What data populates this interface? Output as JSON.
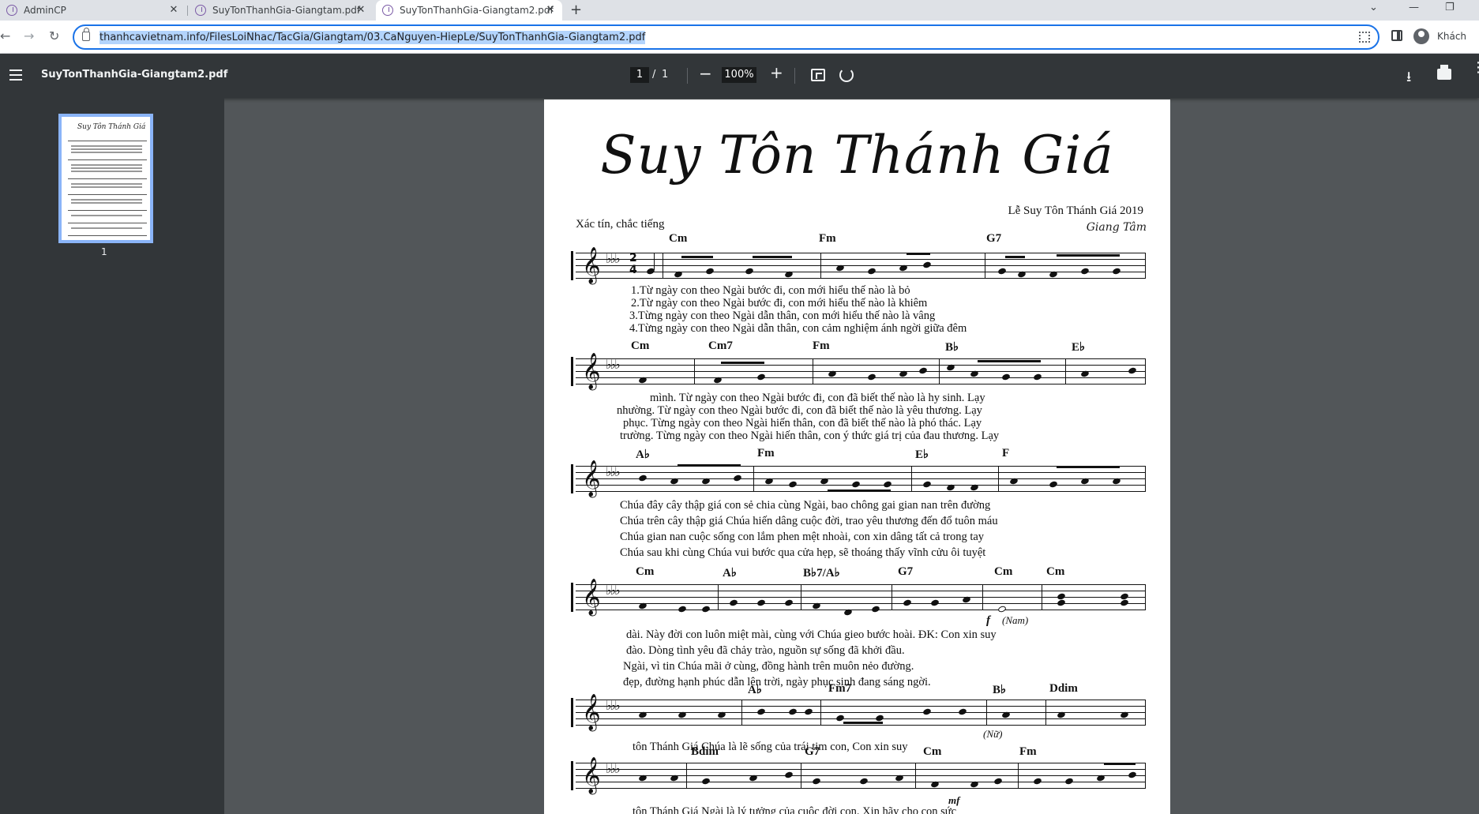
{
  "browser": {
    "tabs": [
      {
        "label": "AdminCP",
        "active": false
      },
      {
        "label": "SuyTonThanhGia-Giangtam.pdf",
        "active": false
      },
      {
        "label": "SuyTonThanhGia-Giangtam2.pdf",
        "active": true
      }
    ],
    "url": "thanhcavietnam.info/FilesLoiNhac/TacGia/Giangtam/03.CaNguyen-HiepLe/SuyTonThanhGia-Giangtam2.pdf",
    "profile_label": "Khách"
  },
  "pdf_viewer": {
    "doc_title": "SuyTonThanhGia-Giangtam2.pdf",
    "page_current": "1",
    "page_sep": "/",
    "page_total": "1",
    "zoom": "100%",
    "thumb_page_number": "1"
  },
  "sheet": {
    "title": "Suy Tôn Thánh Giá",
    "subtitle": "Lễ Suy Tôn Thánh Giá 2019",
    "tempo": "Xác tín, chắc tiếng",
    "composer": "Giang Tâm",
    "systems": [
      {
        "chords": [
          "Cm",
          "Fm",
          "G7"
        ],
        "lyrics": [
          "1.Từ  ngày  con  theo  Ngài  bước  đi,  con  mới  hiểu  thế  nào  là  bỏ",
          "2.Từ  ngày  con  theo  Ngài  bước  đi,  con  mới  hiểu  thế  nào  là  khiêm",
          "3.Từng  ngày  con  theo  Ngài  dẫn  thân,  con  mới  hiểu  thế  nào  là  vâng",
          "4.Từng  ngày  con  theo  Ngài  dẫn  thân,  con  cảm nghiệm ánh ngời giữa đêm"
        ]
      },
      {
        "chords": [
          "Cm",
          "Cm7",
          "Fm",
          "B♭",
          "E♭"
        ],
        "lyrics": [
          "mình.  Từ  ngày  con  theo  Ngài bước  đi,  con  đã  biết  thế  nào  là  hy  sinh.  Lạy",
          "nhường.  Từ  ngày  con  theo  Ngài  bước  đi,  con  đã  biết  thế  nào  là  yêu  thương.  Lạy",
          "phục.  Từng ngày  con  theo  Ngài hiến  thân, con  đã  biết  thế  nào  là  phó  thác.  Lạy",
          "trường.  Từng ngày  con  theo  Ngài  hiến  thân, con  ý  thức  giá  trị  của  đau thương.  Lạy"
        ]
      },
      {
        "chords": [
          "A♭",
          "Fm",
          "E♭",
          "F"
        ],
        "lyrics": [
          "Chúa  đây  cây  thập  giá  con  sẻ  chia  cùng Ngài,  bao chông  gai  gian nan  trên  đường",
          "Chúa  trên  cây  thập  giá  Chúa  hiến  dâng  cuộc  đời,  trao  yêu  thương đến  đổ  tuôn  máu",
          "Chúa  gian  nan  cuộc  sống  con  lắm  phen  mệt  nhoài,  con  xin  dâng  tất  cả  trong  tay",
          "Chúa  sau  khi  cùng  Chúa  vui  bước  qua  cửa  hẹp,  sẽ  thoáng  thấy  vĩnh  cửu  ôi  tuyệt"
        ]
      },
      {
        "chords": [
          "Cm",
          "A♭",
          "B♭7/A♭",
          "G7",
          "Cm",
          "Cm"
        ],
        "dynamic": "f",
        "note": "(Nam)",
        "lyrics": [
          "dài.  Này  đời  con  luôn  miệt  mài,  cùng  với  Chúa  gieo  bước  hoài.  ĐK: Con  xin  suy",
          "đào.  Dòng  tình  yêu  đã  chảy  trào,  nguồn  sự  sống  đã  khởi  đầu.",
          "Ngài,  vì  tin  Chúa  mãi  ở  cùng,  đồng  hành  trên  muôn  nẻo đường.",
          "đẹp,  đường  hạnh  phúc  dẫn  lên  trời,  ngày  phục  sinh  đang  sáng  ngời."
        ]
      },
      {
        "chords": [
          "A♭",
          "Fm7",
          "B♭",
          "Ddim"
        ],
        "note": "(Nữ)",
        "lyrics": [
          "tôn  Thánh  Giá  Chúa  là  lẽ  sống  của  trái  tim  con,  Con  xin  suy"
        ]
      },
      {
        "chords": [
          "Bdim",
          "G7",
          "Cm",
          "Fm"
        ],
        "dynamic": "mf",
        "lyrics": [
          "tôn  Thánh  Giá  Ngài  là  lý  tưởng  của  cuộc  đời  con.  Xin  hãy  cho  con  sức"
        ]
      }
    ]
  },
  "colors": {
    "chrome_bg": "#dee1e6",
    "pdf_toolbar": "#323639",
    "pdf_canvas": "#525659",
    "focus_ring": "#1a73e8",
    "thumb_border": "#8ab4f8"
  }
}
